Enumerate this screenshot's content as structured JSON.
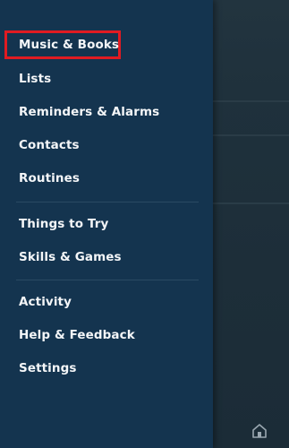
{
  "menu": {
    "group1": [
      {
        "label": "Music & Books"
      },
      {
        "label": "Lists"
      },
      {
        "label": "Reminders & Alarms"
      },
      {
        "label": "Contacts"
      },
      {
        "label": "Routines"
      }
    ],
    "group2": [
      {
        "label": "Things to Try"
      },
      {
        "label": "Skills & Games"
      }
    ],
    "group3": [
      {
        "label": "Activity"
      },
      {
        "label": "Help & Feedback"
      },
      {
        "label": "Settings"
      }
    ]
  },
  "highlight_color": "#e01b22",
  "drawer_color": "#14344f",
  "icons": {
    "bottom_right": "home-icon"
  }
}
